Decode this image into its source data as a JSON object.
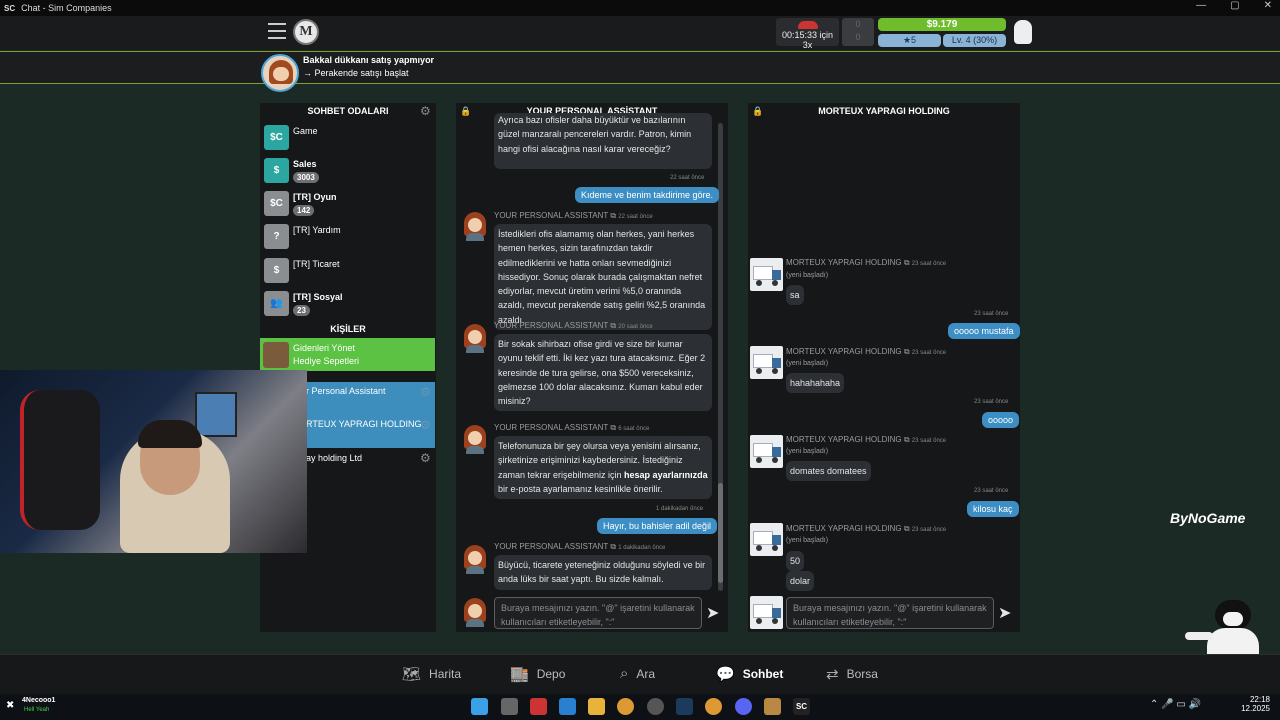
{
  "window": {
    "title": "Chat - Sim Companies",
    "app_abbrev": "SC",
    "controls": [
      "—",
      "▢",
      "✕"
    ]
  },
  "hud": {
    "timer": "00:15:33 için 3x",
    "gray_box_top": "0",
    "gray_box_bottom": "0",
    "money": "$9.179",
    "stars": "5",
    "level": "Lv. 4 (30%)",
    "company_logo": "M"
  },
  "notification": {
    "title": "Bakkal dükkanı satış yapmıyor",
    "subtitle": "→ Perakende satışı başlat"
  },
  "rooms": {
    "header": "SOHBET ODALARI",
    "items": [
      {
        "name": "Game",
        "badge": "",
        "icon": "sc-logo-icon"
      },
      {
        "name": "Sales",
        "badge": "3003",
        "icon": "dollar-tag-icon"
      },
      {
        "name": "[TR] Oyun",
        "badge": "142",
        "icon": "sc-logo-icon"
      },
      {
        "name": "[TR] Yardım",
        "badge": "",
        "icon": "question-icon"
      },
      {
        "name": "[TR] Ticaret",
        "badge": "",
        "icon": "dollar-tag-icon"
      },
      {
        "name": "[TR] Sosyal",
        "badge": "23",
        "icon": "people-icon"
      }
    ],
    "contacts_header": "KİŞİLER",
    "gift_line1": "Gidenleri Yönet",
    "gift_line2": "Hediye Sepetleri",
    "contacts": [
      "r Personal Assistant",
      "RTEUX YAPRAGI HOLDING",
      "ay holding Ltd"
    ]
  },
  "assistant": {
    "header": "YOUR PERSONAL ASSİSTANT",
    "top_message_tail": "Ayrıca bazı ofisler daha büyüktür ve bazılarının güzel manzaralı pencereleri vardır. Patron, kimin hangi ofisi alacağına nasıl karar vereceğiz?",
    "ts1": "22 saat önce",
    "out1": "Kıdeme ve benim takdirime göre.",
    "sender": "YOUR PERSONAL ASSISTANT",
    "m1_time": "22 saat önce",
    "m1": "İstedikleri ofis alamamış olan herkes, yani herkes hemen herkes, sizin tarafınızdan takdir edilmediklerini ve hatta onları sevmediğinizi hissediyor. Sonuç olarak burada çalışmaktan nefret ediyorlar, mevcut üretim verimi %5,0 oranında azaldı, mevcut perakende satış geliri %2,5 oranında azaldı.",
    "m2_time": "20 saat önce",
    "m2": "Bir sokak sihirbazı ofise girdi ve size bir kumar oyunu teklif etti. İki kez yazı tura atacaksınız. Eğer 2 keresinde de tura gelirse, ona $500 vereceksiniz, gelmezse 100 dolar alacaksınız. Kumarı kabul eder misiniz?",
    "m3_time": "6 saat önce",
    "m3_part1": "Telefonunuza bir şey olursa veya yenisini alırsanız, şirketinize erişiminizi kaybedersiniz. İstediğiniz zaman tekrar erişebilmeniz için ",
    "m3_bold": "hesap ayarlarınızda",
    "m3_part2": " bir e-posta ayarlamanız kesinlikle önerilir.",
    "ts2": "1 dakikadan önce",
    "out2": "Hayır, bu bahisler adil değil",
    "m4_time": "1 dakikadan önce",
    "m4": "Büyücü, ticarete yeteneğiniz olduğunu söyledi ve bir anda lüks bir saat yaptı. Bu sizde kalmalı.",
    "placeholder": "Buraya mesajınızı yazın. \"@\" işaretini kullanarak kullanıcıları etiketleyebilir, \":\""
  },
  "holding": {
    "header": "MORTEUX YAPRAGI HOLDING",
    "sender": "MORTEUX YAPRAGI HOLDING",
    "sub": "(yeni başladı)",
    "time": "23 saat önce",
    "h1": "sa",
    "o1": "ooooo mustafa",
    "h2": "hahahahaha",
    "o2": "ooooo",
    "h3": "domates domatees",
    "o3": "kilosu kaç",
    "h4a": "50",
    "h4b": "dolar",
    "placeholder": "Buraya mesajınızı yazın. \"@\" işaretini kullanarak kullanıcıları etiketleyebilir, \":\""
  },
  "nav": {
    "items": [
      "Harita",
      "Depo",
      "Ara",
      "Sohbet",
      "Borsa"
    ]
  },
  "overlay": {
    "brand": "ByNoGame"
  },
  "taskbar": {
    "user": "4Necooo1",
    "user_sub": "Hell Yeah",
    "time": "22:18",
    "date": "12.2025"
  }
}
